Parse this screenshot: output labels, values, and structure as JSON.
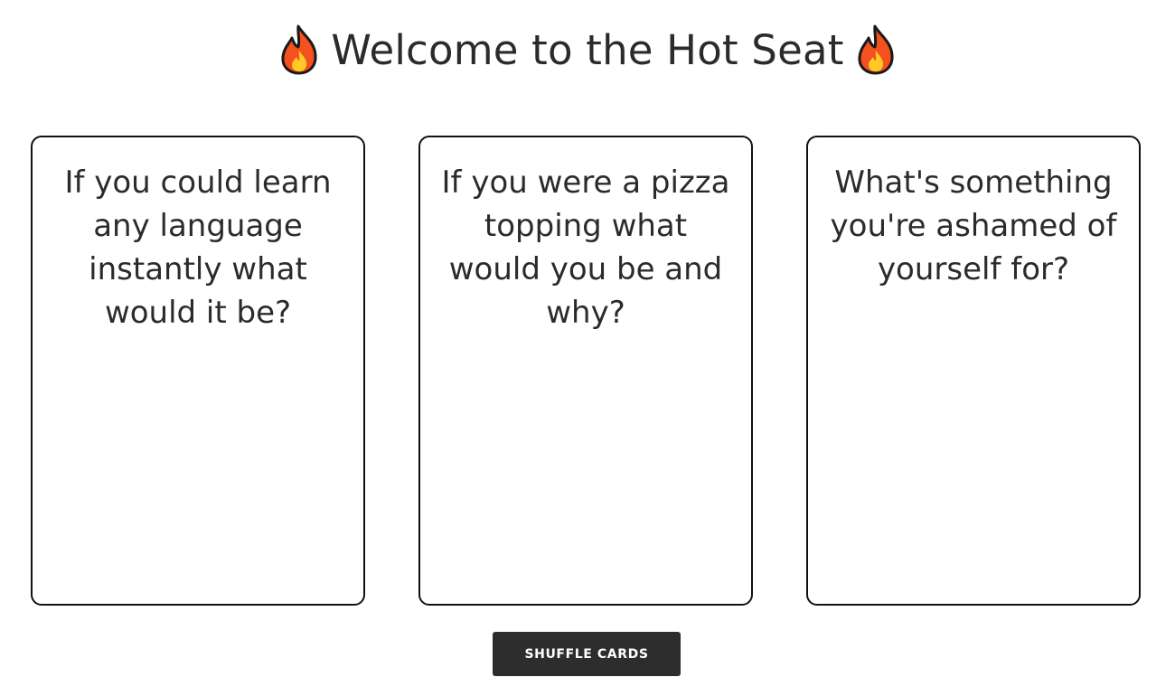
{
  "header": {
    "title": "Welcome to the Hot Seat",
    "left_icon": "fire-icon",
    "right_icon": "fire-icon"
  },
  "cards": [
    {
      "text": "If you could learn any language instantly what would it be?"
    },
    {
      "text": "If you were a pizza topping what would you be and why?"
    },
    {
      "text": "What's something you're ashamed of yourself for?"
    }
  ],
  "controls": {
    "shuffle_label": "SHUFFLE CARDS"
  },
  "colors": {
    "flame_outer": "#f4511e",
    "flame_inner": "#ffca28",
    "button_bg": "#2d2d2d",
    "text": "#2b2b2b",
    "card_border": "#111111"
  }
}
